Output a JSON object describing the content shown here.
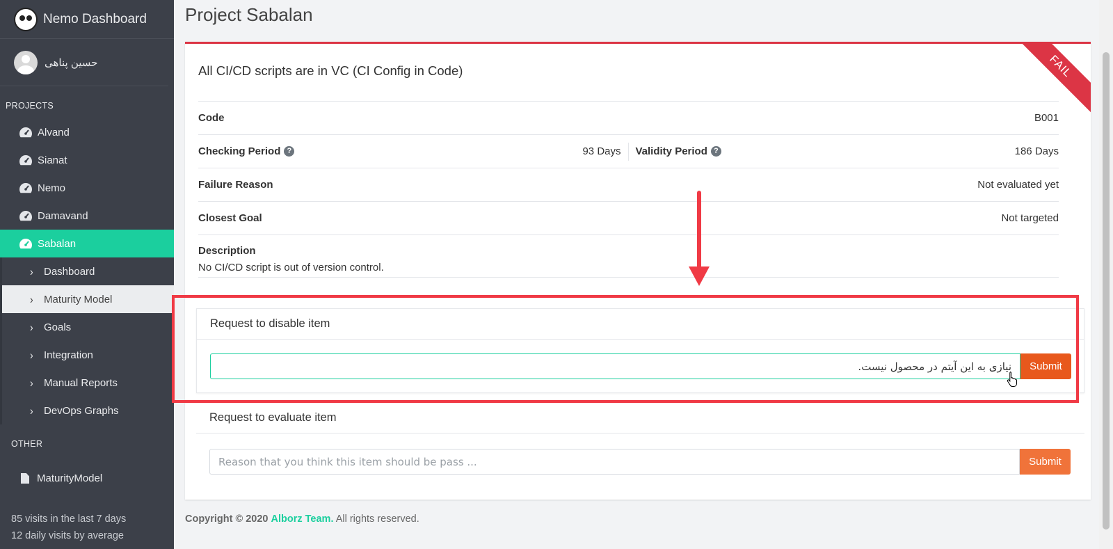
{
  "app": {
    "title": "Nemo Dashboard"
  },
  "user": {
    "name": "حسین پناهی"
  },
  "sidebar": {
    "projects_title": "PROJECTS",
    "projects": [
      {
        "label": "Alvand",
        "icon": "gauge-icon"
      },
      {
        "label": "Sianat",
        "icon": "gauge-icon"
      },
      {
        "label": "Nemo",
        "icon": "gauge-icon"
      },
      {
        "label": "Damavand",
        "icon": "gauge-icon"
      },
      {
        "label": "Sabalan",
        "icon": "gauge-icon",
        "active": true
      }
    ],
    "sub_items": [
      {
        "label": "Dashboard"
      },
      {
        "label": "Maturity Model",
        "selected": true
      },
      {
        "label": "Goals"
      },
      {
        "label": "Integration"
      },
      {
        "label": "Manual Reports"
      },
      {
        "label": "DevOps Graphs"
      }
    ],
    "other_title": "OTHER",
    "other_items": [
      {
        "label": "MaturityModel",
        "icon": "file-icon"
      }
    ],
    "visits_week": "85 visits in the last 7 days",
    "visits_daily": "12 daily visits by average"
  },
  "page": {
    "title": "Project Sabalan"
  },
  "item": {
    "title": "All CI/CD scripts are in VC (CI Config in Code)",
    "status": "FAIL",
    "code_label": "Code",
    "code_value": "B001",
    "checking_period_label": "Checking Period",
    "checking_period_value": "93 Days",
    "validity_period_label": "Validity Period",
    "validity_period_value": "186 Days",
    "failure_reason_label": "Failure Reason",
    "failure_reason_value": "Not evaluated yet",
    "closest_goal_label": "Closest Goal",
    "closest_goal_value": "Not targeted",
    "description_label": "Description",
    "description_value": "No CI/CD script is out of version control."
  },
  "disable_request": {
    "title": "Request to disable item",
    "value": "نیازی به این آیتم در محصول نیست.",
    "submit_label": "Submit"
  },
  "evaluate_request": {
    "title": "Request to evaluate item",
    "placeholder": "Reason that you think this item should be pass ...",
    "submit_label": "Submit"
  },
  "footer": {
    "copyright": "Copyright © 2020",
    "team": "Alborz Team.",
    "rights": "All rights reserved."
  },
  "colors": {
    "sidebar_bg": "#3c4049",
    "accent": "#1bcf9e",
    "fail": "#dc3545",
    "submit": "#e8581c",
    "annotation": "#f03a45"
  }
}
